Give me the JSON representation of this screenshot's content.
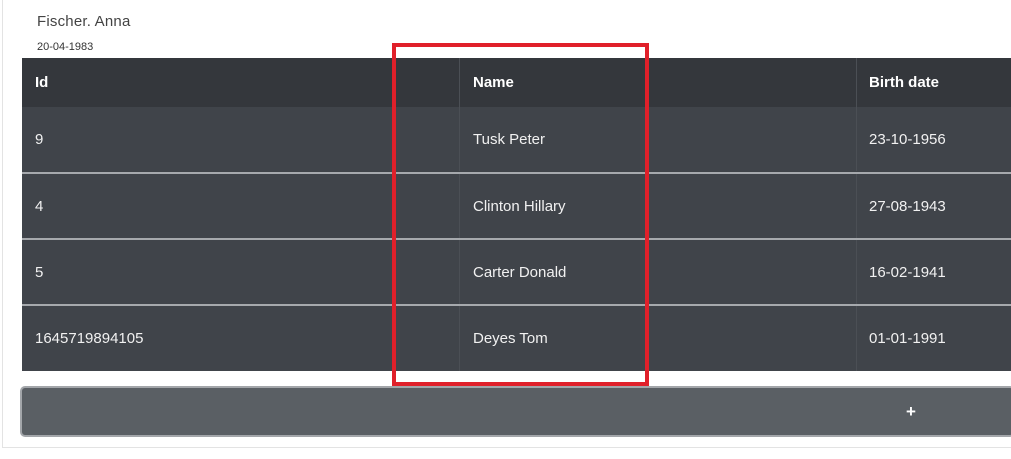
{
  "person": {
    "name": "Fischer. Anna",
    "birth_date": "20-04-1983"
  },
  "table": {
    "headers": {
      "id": "Id",
      "name": "Name",
      "birth_date": "Birth date"
    },
    "rows": [
      {
        "id": "9",
        "name": "Tusk Peter",
        "birth_date": "23-10-1956"
      },
      {
        "id": "4",
        "name": "Clinton Hillary",
        "birth_date": "27-08-1943"
      },
      {
        "id": "5",
        "name": "Carter Donald",
        "birth_date": "16-02-1941"
      },
      {
        "id": "1645719894105",
        "name": "Deyes Tom",
        "birth_date": "01-01-1991"
      }
    ]
  },
  "add_button": {
    "label": "+"
  },
  "highlight": {
    "color": "#e0202a",
    "target": "Name column"
  }
}
